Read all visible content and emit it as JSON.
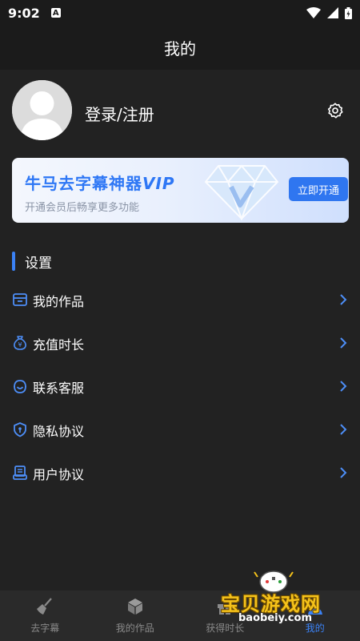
{
  "status_bar": {
    "time": "9:02",
    "notification_letter": "A"
  },
  "header": {
    "title": "我的"
  },
  "profile": {
    "login_label": "登录/注册"
  },
  "vip": {
    "title_main": "牛马去字幕神器",
    "title_vip": "VIP",
    "subtitle": "开通会员后畅享更多功能",
    "button_label": "立即开通"
  },
  "settings": {
    "title": "设置",
    "items": [
      {
        "label": "我的作品",
        "icon": "archive-box-icon"
      },
      {
        "label": "充值时长",
        "icon": "money-bag-icon"
      },
      {
        "label": "联系客服",
        "icon": "headset-icon"
      },
      {
        "label": "隐私协议",
        "icon": "shield-icon"
      },
      {
        "label": "用户协议",
        "icon": "document-icon"
      }
    ]
  },
  "bottom_nav": {
    "items": [
      {
        "label": "去字幕",
        "icon": "broom-icon",
        "active": false
      },
      {
        "label": "我的作品",
        "icon": "cube-icon",
        "active": false
      },
      {
        "label": "获得时长",
        "icon": "gift-icon",
        "active": false
      },
      {
        "label": "我的",
        "icon": "person-icon",
        "active": true
      }
    ]
  },
  "watermark": {
    "text": "宝贝游戏网",
    "url": "baobeiy.com"
  },
  "colors": {
    "accent": "#3b82f6",
    "background": "#222222",
    "header": "#1b1b1b",
    "vip_button": "#2f76f0"
  }
}
